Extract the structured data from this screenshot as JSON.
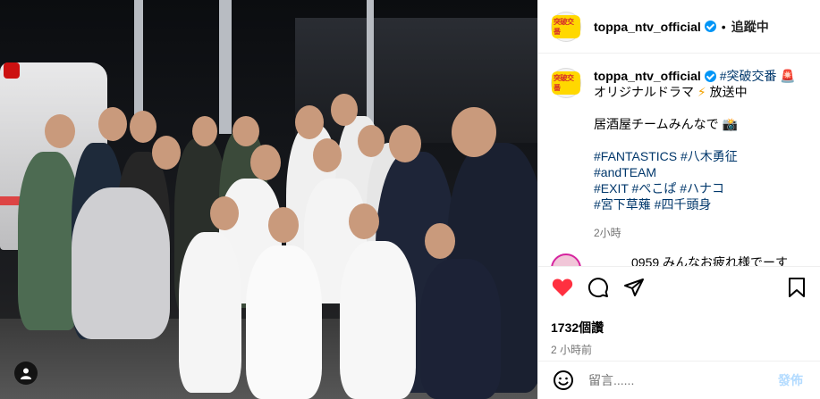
{
  "header": {
    "username": "toppa_ntv_official",
    "logo_text": "突破交番",
    "follow_label": "追蹤中",
    "separator": "•"
  },
  "caption": {
    "username": "toppa_ntv_official",
    "hashtag_title": "#突破交番",
    "emoji_siren": "🚨",
    "line2_text": "オリジナルドラマ",
    "emoji_bolt": "⚡",
    "line2_suffix": "放送中",
    "line3_text": "居酒屋チームみんなで",
    "emoji_camera": "📸",
    "tags_line1": "#FANTASTICS #八木勇征",
    "tags_line2": "#andTEAM",
    "tags_line3": "#EXIT #ぺこぱ #ハナコ",
    "tags_line4": "#宮下草薙 #四千頭身",
    "time": "2小時"
  },
  "comment_peek": {
    "text": "　　　0959 みんなお疲れ様でーす"
  },
  "actions": {
    "like_icon": "heart-icon",
    "comment_icon": "comment-icon",
    "share_icon": "share-icon",
    "save_icon": "bookmark-icon",
    "like_color": "#ff3040"
  },
  "likes": "1732個讚",
  "post_time": "2 小時前",
  "comment_box": {
    "placeholder": "留言......",
    "post_label": "發佈",
    "emoji_icon": "smiley-icon"
  },
  "photo": {
    "tag_icon": "user-tag-icon"
  }
}
